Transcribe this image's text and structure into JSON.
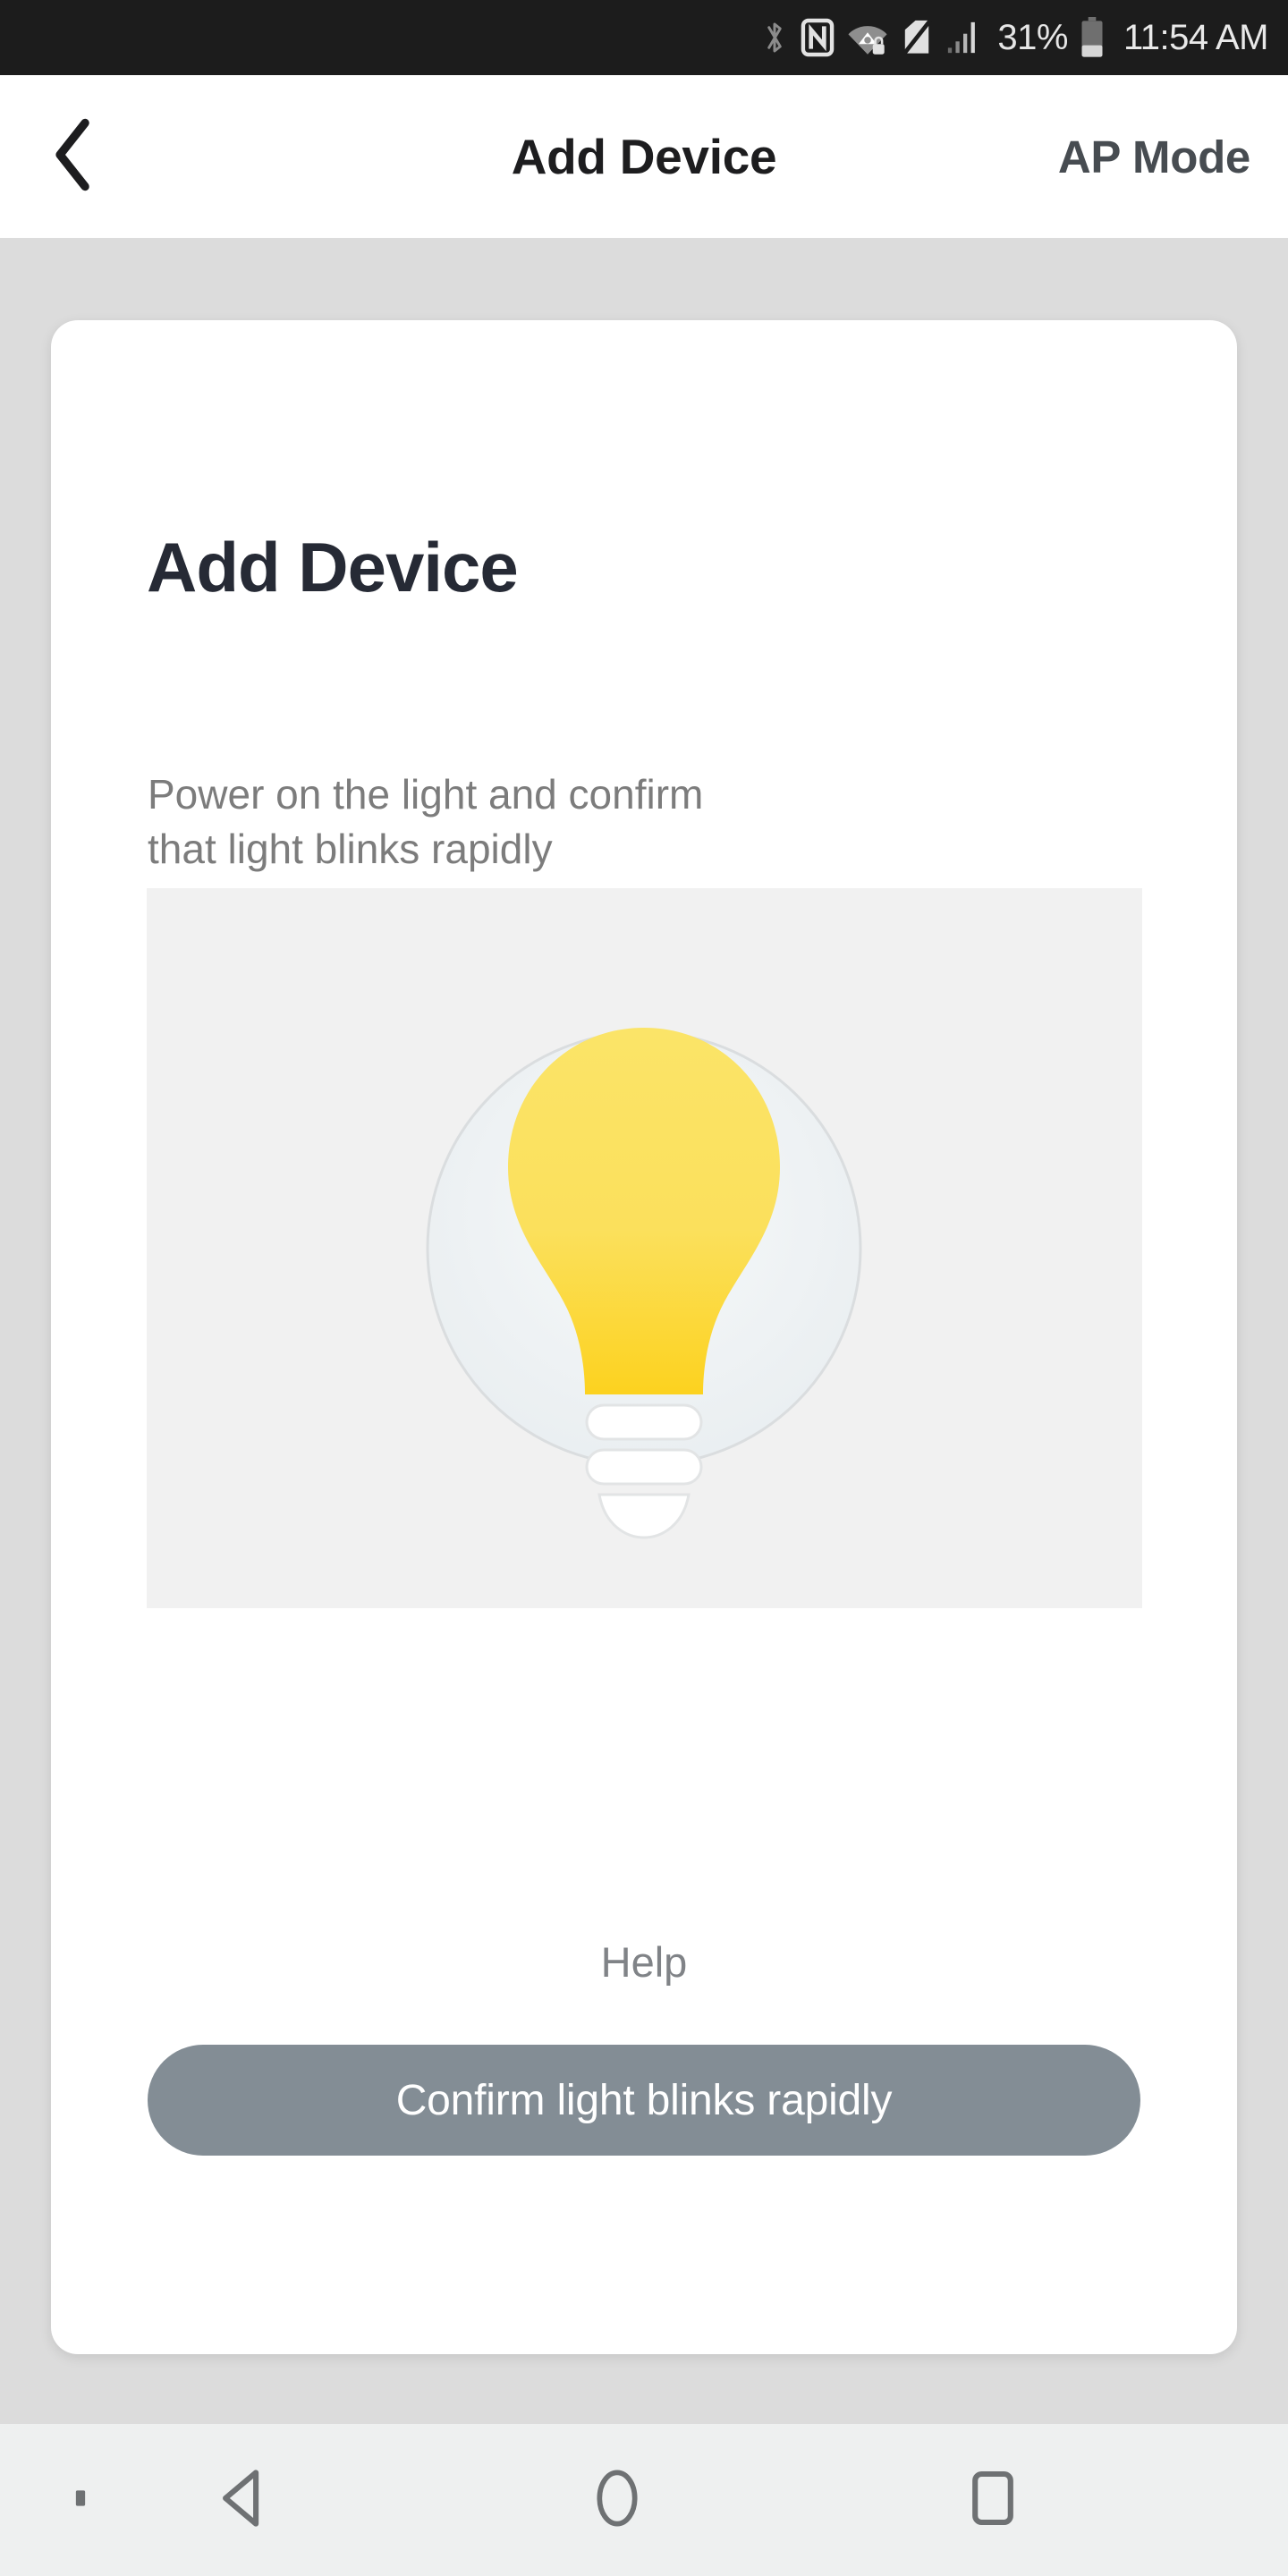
{
  "status_bar": {
    "icons": [
      "bluetooth-icon",
      "nfc-icon",
      "wifi-secured-icon",
      "sim-off-icon",
      "cellular-signal-icon"
    ],
    "battery_percent": "31%",
    "battery_level": 31,
    "clock": "11:54 AM",
    "background_color": "#1c1c1c",
    "text_color": "#e9e9e9"
  },
  "header": {
    "back_icon": "chevron-left-icon",
    "title": "Add Device",
    "action_label": "AP Mode",
    "background_color": "#ffffff",
    "title_color": "#1d1d1f",
    "action_color": "#474c51"
  },
  "card": {
    "title": "Add Device",
    "description": "Power on the light and confirm\nthat light blinks  rapidly",
    "title_color": "#262a35",
    "description_color": "#7c7c7c",
    "background_color": "#ffffff"
  },
  "illustration": {
    "name": "light-bulb-illustration",
    "panel_color": "#f1f1f1",
    "circle_color": "#eef2f4",
    "circle_border_color": "#dadddf",
    "bulb_color_top": "#fbe264",
    "bulb_color_bottom": "#fcd21f",
    "base_color": "#ffffff",
    "base_border_color": "#e2e4e5"
  },
  "actions": {
    "help_label": "Help",
    "help_color": "#808387",
    "confirm_label": "Confirm light blinks rapidly",
    "confirm_background": "#838d95",
    "confirm_text_color": "#ffffff"
  },
  "nav_bar": {
    "background_color": "#eef0f0",
    "icon_color": "#6e7173",
    "items": [
      {
        "name": "nav-dot-indicator",
        "icon": "dot-icon"
      },
      {
        "name": "nav-back",
        "icon": "triangle-back-icon"
      },
      {
        "name": "nav-home",
        "icon": "circle-home-icon"
      },
      {
        "name": "nav-recents",
        "icon": "square-recents-icon"
      }
    ]
  },
  "page": {
    "background_color": "#dcdcdc"
  }
}
